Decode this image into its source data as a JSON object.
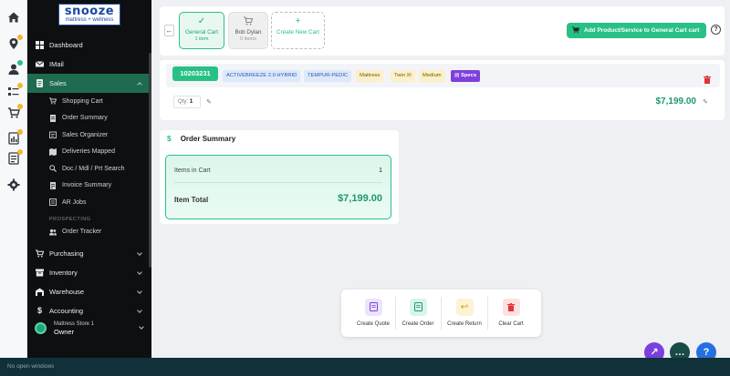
{
  "brand": {
    "name": "snooze",
    "tagline": "mattress + wellness"
  },
  "sidebar": {
    "items": [
      {
        "label": "Dashboard",
        "icon": "grid-icon"
      },
      {
        "label": "IMail",
        "icon": "mail-icon"
      },
      {
        "label": "Sales",
        "icon": "document-icon",
        "active": true
      }
    ],
    "sales_sub": [
      {
        "label": "Shopping Cart",
        "icon": "cart-icon"
      },
      {
        "label": "Order Summary",
        "icon": "list-icon"
      },
      {
        "label": "Sales Organizer",
        "icon": "organizer-icon"
      },
      {
        "label": "Deliveries Mapped",
        "icon": "map-icon"
      },
      {
        "label": "Doc / Mdl / Prt Search",
        "icon": "search-icon"
      },
      {
        "label": "Invoice Summary",
        "icon": "invoice-icon"
      },
      {
        "label": "AR Jobs",
        "icon": "jobs-icon"
      }
    ],
    "section_label": "PROSPECTING",
    "prospecting_sub": [
      {
        "label": "Order Tracker",
        "icon": "users-icon"
      }
    ],
    "lower_items": [
      {
        "label": "Purchasing",
        "icon": "cart-icon"
      },
      {
        "label": "Inventory",
        "icon": "box-icon"
      },
      {
        "label": "Warehouse",
        "icon": "warehouse-icon"
      },
      {
        "label": "Accounting",
        "icon": "dollar-icon"
      }
    ],
    "store": {
      "name": "Mattress Store 1",
      "role": "Owner"
    }
  },
  "carts": {
    "tabs": [
      {
        "name": "General Cart",
        "sub": "1 item"
      },
      {
        "name": "Bob Dylan",
        "sub": "0 items"
      },
      {
        "name": "Create New Cart",
        "sub": ""
      }
    ],
    "add_button": "Add Product/Service to General Cart cart"
  },
  "cart_item": {
    "sku": "10203231",
    "chips": [
      "ACTIVEBREEZE 2.0 HYBRID",
      "TEMPUR-PEDIC",
      "Mattress",
      "Twin Xl",
      "Medium"
    ],
    "specs_label": "Specs",
    "qty_label": "Qty:",
    "qty_value": "1",
    "price": "$7,199.00"
  },
  "summary": {
    "title": "Order Summary",
    "items_label": "Items in Cart",
    "items_value": "1",
    "total_label": "Item Total",
    "total_value": "$7,199.00"
  },
  "actions": [
    {
      "label": "Create Quote",
      "icon": "quote-icon"
    },
    {
      "label": "Create Order",
      "icon": "order-icon"
    },
    {
      "label": "Create Return",
      "icon": "return-icon"
    },
    {
      "label": "Clear Cart",
      "icon": "trash-icon"
    }
  ],
  "taskbar": {
    "text": "No open windows"
  },
  "colors": {
    "accent": "#29c086",
    "sidebar_bg": "#0e0f10",
    "active_nav": "#1e6b50",
    "purple": "#7f3fdc"
  }
}
